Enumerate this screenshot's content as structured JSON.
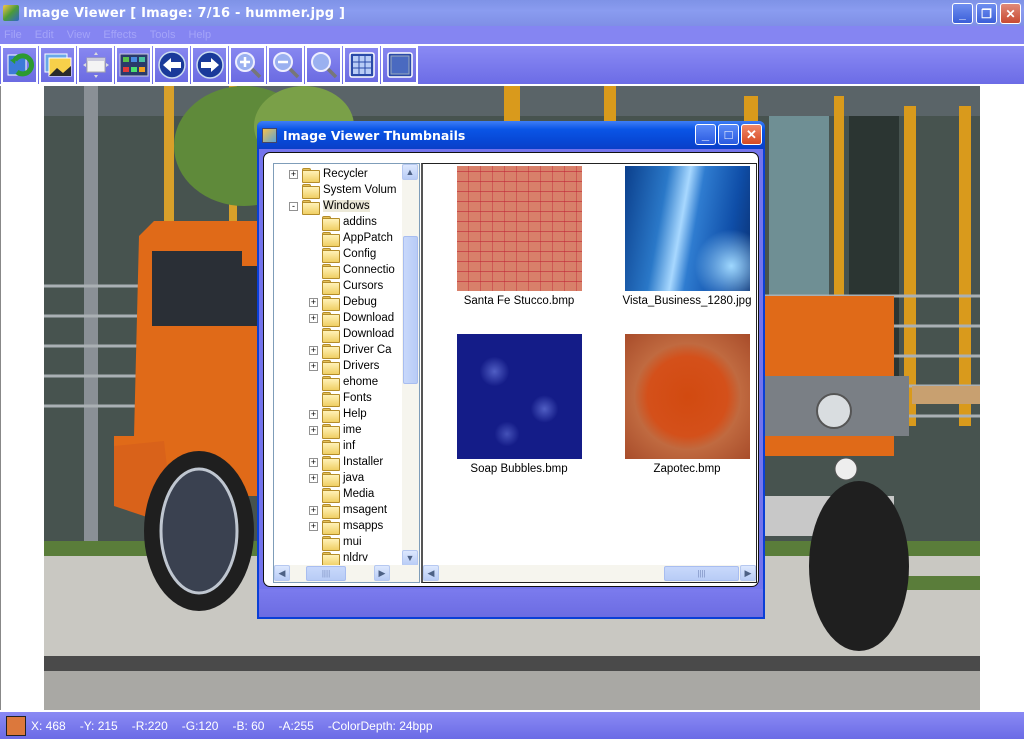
{
  "app": {
    "title": "Image Viewer [ Image: 7/16 - hummer.jpg ]",
    "window_buttons": {
      "minimize": "_",
      "restore": "❐",
      "close": "✕"
    }
  },
  "menu": [
    "File",
    "Edit",
    "View",
    "Effects",
    "Tools",
    "Help"
  ],
  "toolbar": [
    {
      "name": "open-folder-icon",
      "tooltip": "Open"
    },
    {
      "name": "image-icon",
      "tooltip": "Images"
    },
    {
      "name": "fit-window-icon",
      "tooltip": "Fit"
    },
    {
      "name": "thumbnails-icon",
      "tooltip": "Thumbnails"
    },
    {
      "name": "previous-arrow-icon",
      "tooltip": "Previous"
    },
    {
      "name": "next-arrow-icon",
      "tooltip": "Next"
    },
    {
      "name": "zoom-in-icon",
      "tooltip": "Zoom In"
    },
    {
      "name": "zoom-out-icon",
      "tooltip": "Zoom Out"
    },
    {
      "name": "zoom-actual-icon",
      "tooltip": "Zoom"
    },
    {
      "name": "grid-view-icon",
      "tooltip": "Grid"
    },
    {
      "name": "full-view-icon",
      "tooltip": "Full"
    }
  ],
  "image": {
    "description": "Orange Hummer parked in front of building",
    "filename": "hummer.jpg"
  },
  "status": {
    "swatch_color": "#dc783c",
    "x": "X: 468",
    "y": "-Y: 215",
    "r": "-R:220",
    "g": "-G:120",
    "b": "-B: 60",
    "a": "-A:255",
    "depth": "-ColorDepth: 24bpp"
  },
  "thumbnails_dialog": {
    "title": "Image Viewer Thumbnails",
    "tree": [
      {
        "label": "Recycler",
        "level": 0,
        "expander": "+"
      },
      {
        "label": "System Volum",
        "level": 0,
        "expander": ""
      },
      {
        "label": "Windows",
        "level": 0,
        "expander": "-",
        "selected": true
      },
      {
        "label": "addins",
        "level": 1,
        "expander": ""
      },
      {
        "label": "AppPatch",
        "level": 1,
        "expander": ""
      },
      {
        "label": "Config",
        "level": 1,
        "expander": ""
      },
      {
        "label": "Connectio",
        "level": 1,
        "expander": ""
      },
      {
        "label": "Cursors",
        "level": 1,
        "expander": ""
      },
      {
        "label": "Debug",
        "level": 1,
        "expander": "+"
      },
      {
        "label": "Download",
        "level": 1,
        "expander": "+"
      },
      {
        "label": "Download",
        "level": 1,
        "expander": ""
      },
      {
        "label": "Driver Ca",
        "level": 1,
        "expander": "+"
      },
      {
        "label": "Drivers",
        "level": 1,
        "expander": "+"
      },
      {
        "label": "ehome",
        "level": 1,
        "expander": ""
      },
      {
        "label": "Fonts",
        "level": 1,
        "expander": ""
      },
      {
        "label": "Help",
        "level": 1,
        "expander": "+"
      },
      {
        "label": "ime",
        "level": 1,
        "expander": "+"
      },
      {
        "label": "inf",
        "level": 1,
        "expander": ""
      },
      {
        "label": "Installer",
        "level": 1,
        "expander": "+"
      },
      {
        "label": "java",
        "level": 1,
        "expander": "+"
      },
      {
        "label": "Media",
        "level": 1,
        "expander": ""
      },
      {
        "label": "msagent",
        "level": 1,
        "expander": "+"
      },
      {
        "label": "msapps",
        "level": 1,
        "expander": "+"
      },
      {
        "label": "mui",
        "level": 1,
        "expander": ""
      },
      {
        "label": "nldrv",
        "level": 1,
        "expander": ""
      }
    ],
    "thumbnails": [
      {
        "label": "Santa Fe Stucco.bmp",
        "style": "img-stucco"
      },
      {
        "label": "Vista_Business_1280.jpg",
        "style": "img-vista"
      },
      {
        "label": "Soap Bubbles.bmp",
        "style": "img-bubbles"
      },
      {
        "label": "Zapotec.bmp",
        "style": "img-zapotec"
      }
    ],
    "scroll": {
      "up": "▲",
      "down": "▼",
      "left": "◀",
      "right": "▶",
      "grip": "||||"
    }
  }
}
